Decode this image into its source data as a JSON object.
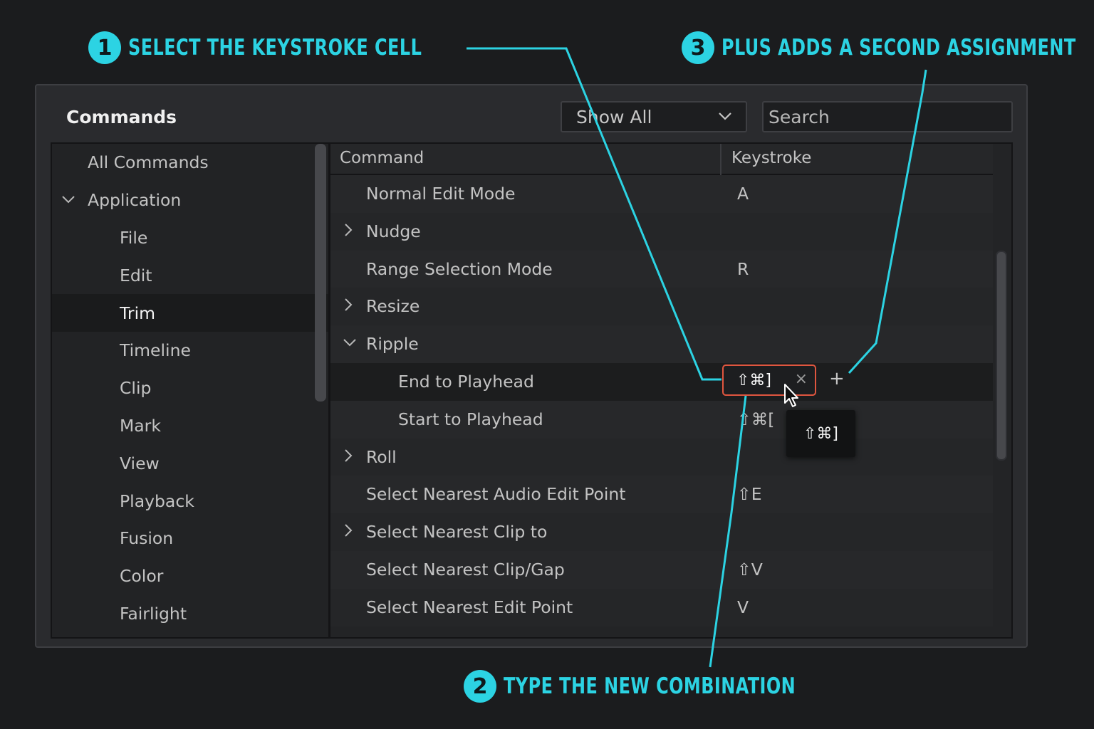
{
  "callouts": {
    "step1": {
      "number": "1",
      "text": "SELECT THE KEYSTROKE CELL"
    },
    "step2": {
      "number": "2",
      "text": "TYPE THE NEW COMBINATION"
    },
    "step3": {
      "number": "3",
      "text": "PLUS ADDS A SECOND ASSIGNMENT"
    }
  },
  "panel": {
    "title": "Commands",
    "filter_dropdown": {
      "selected": "Show All",
      "icon": "chevron-down-icon"
    },
    "search": {
      "placeholder": "Search"
    }
  },
  "sidebar": {
    "items": [
      {
        "label": "All Commands"
      },
      {
        "label": "Application",
        "expanded": true
      },
      {
        "label": "File"
      },
      {
        "label": "Edit"
      },
      {
        "label": "Trim",
        "selected": true
      },
      {
        "label": "Timeline"
      },
      {
        "label": "Clip"
      },
      {
        "label": "Mark"
      },
      {
        "label": "View"
      },
      {
        "label": "Playback"
      },
      {
        "label": "Fusion"
      },
      {
        "label": "Color"
      },
      {
        "label": "Fairlight"
      }
    ]
  },
  "table": {
    "columns": {
      "command": "Command",
      "keystroke": "Keystroke"
    },
    "rows": [
      {
        "command": "Normal Edit Mode",
        "keystroke": "A"
      },
      {
        "command": "Nudge",
        "keystroke": "",
        "expandable": true
      },
      {
        "command": "Range Selection Mode",
        "keystroke": "R"
      },
      {
        "command": "Resize",
        "keystroke": "",
        "expandable": true
      },
      {
        "command": "Ripple",
        "keystroke": "",
        "expanded": true
      },
      {
        "command": "End to Playhead",
        "keystroke": "⇧⌘]",
        "selected": true
      },
      {
        "command": "Start to Playhead",
        "keystroke": "⇧⌘["
      },
      {
        "command": "Roll",
        "keystroke": "",
        "expandable": true
      },
      {
        "command": "Select Nearest Audio Edit Point",
        "keystroke": "⇧E"
      },
      {
        "command": "Select Nearest Clip to",
        "keystroke": "",
        "expandable": true
      },
      {
        "command": "Select Nearest Clip/Gap",
        "keystroke": "⇧V"
      },
      {
        "command": "Select Nearest Edit Point",
        "keystroke": "V"
      }
    ],
    "edit_cell": {
      "value": "⇧⌘]",
      "clear_glyph": "×",
      "add_glyph": "+"
    },
    "tooltip": "⇧⌘]"
  },
  "glyphs": {
    "expanded": "⌵",
    "collapsed": "›"
  },
  "colors": {
    "accent": "#2cd3e3",
    "edit_border": "#e0563f",
    "background": "#1b1c1e",
    "panel": "#2a2b2e"
  }
}
